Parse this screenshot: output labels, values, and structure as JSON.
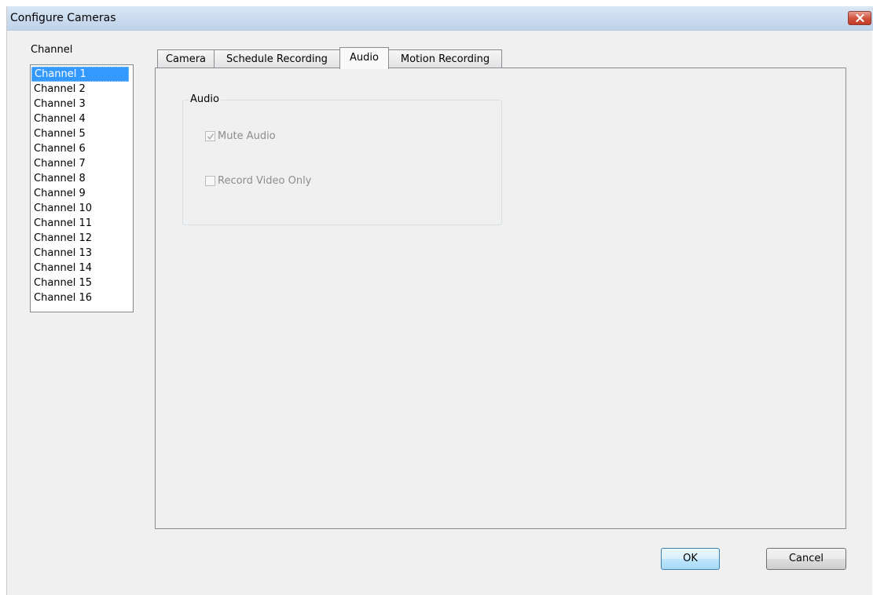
{
  "window": {
    "title": "Configure Cameras"
  },
  "icons": {
    "close": "close-icon",
    "check": "checkmark-icon"
  },
  "channel_panel": {
    "label": "Channel",
    "selected_index": 0,
    "items": [
      "Channel 1",
      "Channel 2",
      "Channel 3",
      "Channel 4",
      "Channel 5",
      "Channel 6",
      "Channel 7",
      "Channel 8",
      "Channel 9",
      "Channel 10",
      "Channel 11",
      "Channel 12",
      "Channel 13",
      "Channel 14",
      "Channel 15",
      "Channel 16"
    ]
  },
  "tabs": {
    "active": "Audio",
    "items": [
      "Camera",
      "Schedule Recording",
      "Audio",
      "Motion Recording"
    ]
  },
  "audio_group": {
    "title": "Audio",
    "mute_audio": {
      "label": "Mute Audio",
      "checked": true,
      "enabled": false
    },
    "record_video_only": {
      "label": "Record Video Only",
      "checked": false,
      "enabled": false
    }
  },
  "buttons": {
    "ok": "OK",
    "cancel": "Cancel"
  },
  "colors": {
    "selection": "#3399ff",
    "window_bg": "#f0f0f0",
    "close_button": "#c23a25"
  }
}
